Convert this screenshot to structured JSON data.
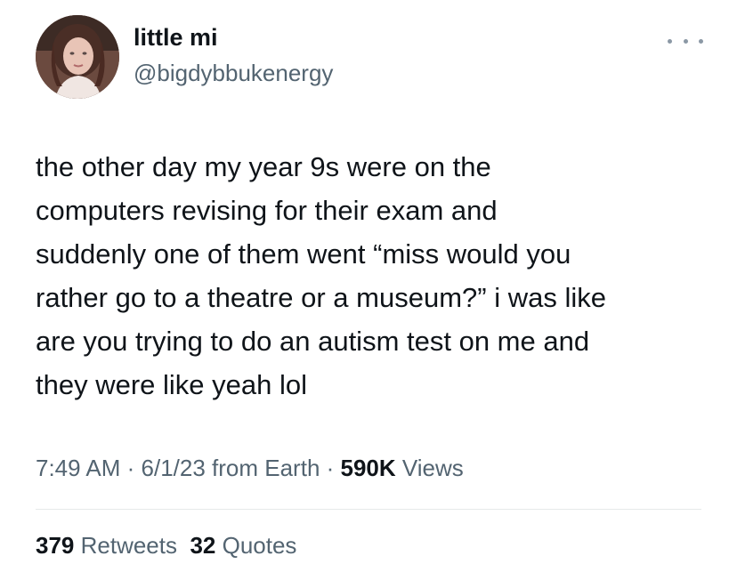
{
  "user": {
    "display_name": "little mi",
    "handle": "@bigdybbukenergy",
    "avatar": "profile-photo"
  },
  "more_icon": "ellipsis-icon",
  "tweet": {
    "text": "the other day my year 9s were on the\ncomputers revising for their exam and\nsuddenly one of them went “miss would you\nrather go to a theatre or a museum?” i was like\nare you trying to do an autism test on me and\nthey were like yeah lol"
  },
  "meta": {
    "time": "7:49 AM",
    "sep1": " · ",
    "date": "6/1/23",
    "source": " from Earth",
    "sep2": " · ",
    "views_count": "590K",
    "views_label": " Views"
  },
  "stats": {
    "retweets_count": "379",
    "retweets_label": " Retweets",
    "quotes_count": "32",
    "quotes_label": " Quotes"
  },
  "colors": {
    "primary_text": "#0f1419",
    "secondary_text": "#536471",
    "divider": "#e6e9ea"
  }
}
